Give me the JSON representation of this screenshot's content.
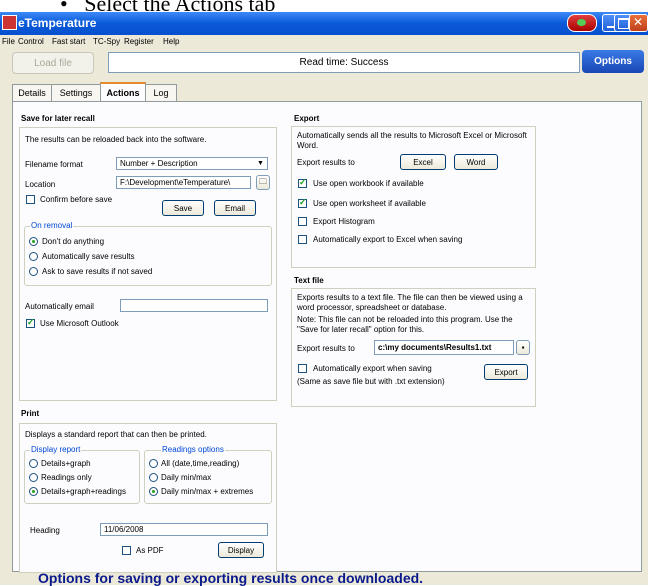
{
  "caption": "Select the Actions tab",
  "window": {
    "title": "eTemperature"
  },
  "menu": [
    "File",
    "Control",
    "Fast start",
    "TC-Spy",
    "Register",
    "Help"
  ],
  "toolbar": {
    "load_file": "Load file",
    "read_time": "Read time: Success",
    "options": "Options"
  },
  "tabs": [
    {
      "label": "Details",
      "active": false
    },
    {
      "label": "Settings",
      "active": false
    },
    {
      "label": "Actions",
      "active": true
    },
    {
      "label": "Log",
      "active": false
    }
  ],
  "save": {
    "title": "Save for later recall",
    "desc": "The results can be reloaded back into the software.",
    "filename_format_label": "Filename format",
    "filename_format_value": "Number + Description",
    "location_label": "Location",
    "location_value": "F:\\Development\\eTemperature\\",
    "confirm_label": "Confirm before save",
    "save_btn": "Save",
    "email_btn": "Email",
    "on_removal_title": "On removal",
    "removal_options": [
      "Don't do anything",
      "Automatically save results",
      "Ask to save results if not saved"
    ],
    "auto_email_label": "Automatically email",
    "auto_email_value": "",
    "use_outlook_label": "Use Microsoft Outlook"
  },
  "export": {
    "title": "Export",
    "desc": "Automatically sends all the results to Microsoft Excel or Microsoft Word.",
    "export_to_label": "Export results to",
    "excel_btn": "Excel",
    "word_btn": "Word",
    "options": [
      {
        "label": "Use open workbook if available",
        "checked": true
      },
      {
        "label": "Use open worksheet if available",
        "checked": true
      },
      {
        "label": "Export Histogram",
        "checked": false
      },
      {
        "label": "Automatically export to Excel when saving",
        "checked": false
      }
    ]
  },
  "textfile": {
    "title": "Text file",
    "desc": "Exports results to a text file. The file can then be viewed using a word processor, spreadsheet or database.",
    "note": "Note: This file can not be reloaded into this program. Use the \"Save for later recall\" option for this.",
    "export_to_label": "Export results to",
    "path_value": "c:\\my documents\\Results1.txt",
    "auto_export_label": "Automatically export when saving",
    "auto_export_sub": "(Same as save file but with .txt extension)",
    "export_btn": "Export"
  },
  "print": {
    "title": "Print",
    "desc": "Displays a standard report that can then be printed.",
    "display_report_title": "Display report",
    "display_report_options": [
      "Details+graph",
      "Readings only",
      "Details+graph+readings"
    ],
    "readings_options_title": "Readings options",
    "readings_options": [
      "All (date,time,reading)",
      "Daily min/max",
      "Daily min/max + extremes"
    ],
    "heading_label": "Heading",
    "heading_value": "11/06/2008",
    "as_pdf_label": "As PDF",
    "display_btn": "Display"
  },
  "footer": "Options for saving or exporting results once downloaded."
}
